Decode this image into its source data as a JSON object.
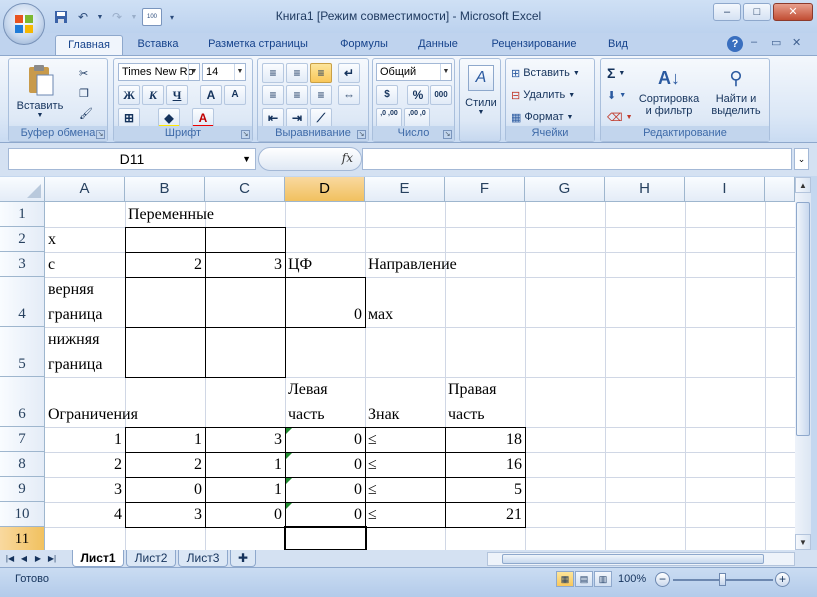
{
  "window": {
    "title": "Книга1  [Режим совместимости] - Microsoft Excel",
    "minimize": "–",
    "maximize": "□",
    "close": "✕"
  },
  "tabs": [
    "Главная",
    "Вставка",
    "Разметка страницы",
    "Формулы",
    "Данные",
    "Рецензирование",
    "Вид"
  ],
  "ribbon": {
    "clipboard": {
      "paste": "Вставить",
      "label": "Буфер обмена"
    },
    "font": {
      "name": "Times New Ro",
      "size": "14",
      "bold": "Ж",
      "italic": "К",
      "underline": "Ч",
      "grow": "A",
      "shrink": "A",
      "label": "Шрифт"
    },
    "alignment": {
      "label": "Выравнивание"
    },
    "number": {
      "format": "Общий",
      "percent": "%",
      "thousands": "000",
      "inc": ",0 ,00",
      "dec": ",00 ,0",
      "label": "Число"
    },
    "styles": {
      "label": "Стили"
    },
    "cells": {
      "insert": "Вставить",
      "delete": "Удалить",
      "format": "Формат",
      "label": "Ячейки"
    },
    "editing": {
      "sort": "Сортировка и фильтр",
      "find": "Найти и выделить",
      "label": "Редактирование"
    }
  },
  "formula_bar": {
    "name_box": "D11",
    "fx": "fx",
    "value": ""
  },
  "columns": [
    "A",
    "B",
    "C",
    "D",
    "E",
    "F",
    "G",
    "H",
    "I"
  ],
  "rows": [
    "1",
    "2",
    "3",
    "4",
    "5",
    "6",
    "7",
    "8",
    "9",
    "10",
    "11"
  ],
  "cells": {
    "B1": "Переменные",
    "A2": "x",
    "A3": "c",
    "B3": "2",
    "C3": "3",
    "D3": "ЦФ",
    "E3": "Направление",
    "A4": "верняя граница",
    "D4": "0",
    "E4": "мах",
    "A5": "нижняя граница",
    "A6": "Ограничения",
    "D6": "Левая часть",
    "E6": "Знак",
    "F6": "Правая часть",
    "A7": "1",
    "B7": "1",
    "C7": "3",
    "D7": "0",
    "E7": "≤",
    "F7": "18",
    "A8": "2",
    "B8": "2",
    "C8": "1",
    "D8": "0",
    "E8": "≤",
    "F8": "16",
    "A9": "3",
    "B9": "0",
    "C9": "1",
    "D9": "0",
    "E9": "≤",
    "F9": "5",
    "A10": "4",
    "B10": "3",
    "C10": "0",
    "D10": "0",
    "E10": "≤",
    "F10": "21"
  },
  "sheets": [
    "Лист1",
    "Лист2",
    "Лист3"
  ],
  "status": {
    "ready": "Готово",
    "zoom": "100%"
  }
}
